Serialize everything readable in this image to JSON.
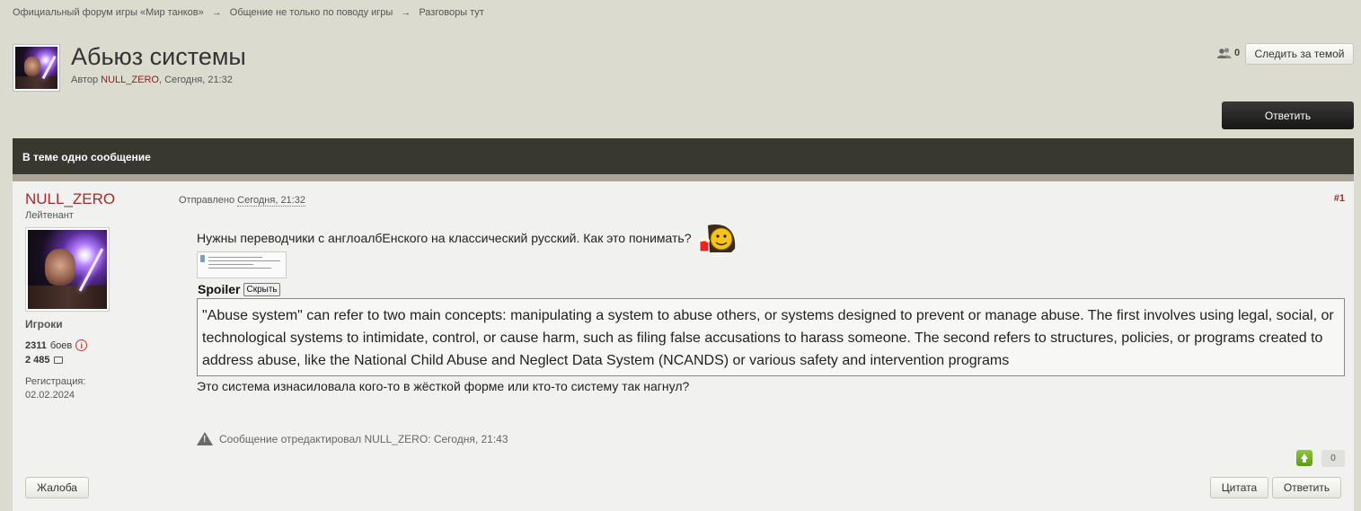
{
  "breadcrumb": [
    "Официальный форум игры «Мир танков»",
    "Общение не только по поводу игры",
    "Разговоры тут"
  ],
  "breadcrumb_separator": "→",
  "topic": {
    "title": "Абьюз системы",
    "meta_prefix": "Автор ",
    "author": "NULL_ZERO",
    "meta_suffix": ", Сегодня, 21:32",
    "followers_count": "0",
    "follow_label": "Следить за темой",
    "reply_label": "Ответить"
  },
  "thread_bar": "В теме одно сообщение",
  "post": {
    "author": "NULL_ZERO",
    "rank": "Лейтенант",
    "group": "Игроки",
    "battles_value": "2311",
    "battles_label": "боев",
    "posts_value": "2 485",
    "reg_label": "Регистрация:",
    "reg_date": "02.02.2024",
    "date_prefix": "Отправлено ",
    "date": "Сегодня, 21:32",
    "number": "#1",
    "text1": "Нужны переводчики с англоалбЕнского на классический русский. Как это понимать?",
    "spoiler_label": "Spoiler",
    "spoiler_button": "Скрыть",
    "spoiler_text": "\"Abuse system\" can refer to two main concepts: manipulating a system to abuse others, or systems designed to prevent or manage abuse. The first involves using legal, social, or technological systems to intimidate, control, or cause harm, such as filing false accusations to harass someone. The second refers to structures, policies, or programs created to address abuse, like the National Child Abuse and Neglect Data System (NCANDS) or various safety and intervention programs",
    "text2": "Это система изнасиловала кого-то в жёсткой форме или кто-то систему так нагнул?",
    "edit_note": "Сообщение отредактировал NULL_ZERO: Сегодня, 21:43",
    "reputation": "0",
    "report_label": "Жалоба",
    "quote_label": "Цитата",
    "reply_label": "Ответить"
  },
  "colors": {
    "background": "#dcdbcf",
    "thread_bar": "#393830",
    "author_name": "#9b2f2f",
    "rep_up": "#6fae22"
  }
}
